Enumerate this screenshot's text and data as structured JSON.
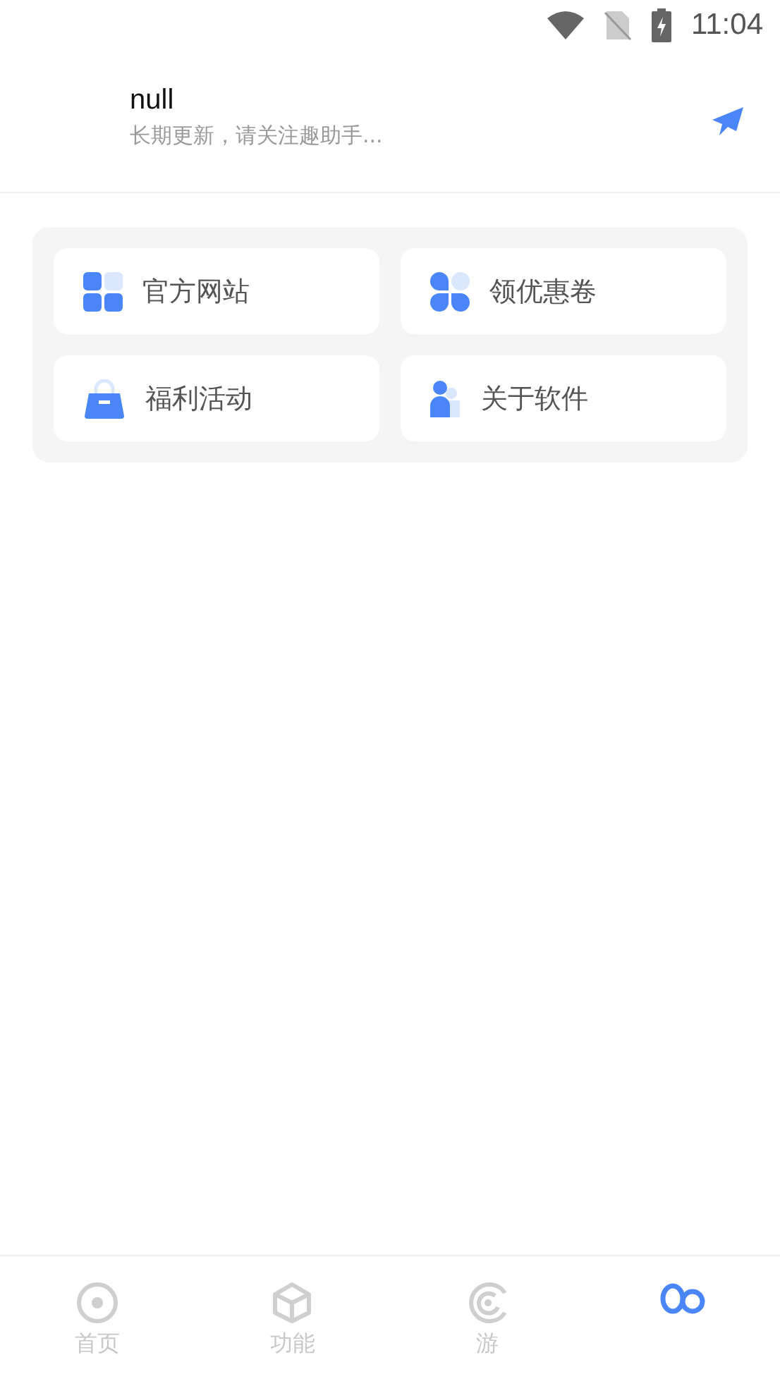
{
  "status_bar": {
    "time": "11:04"
  },
  "header": {
    "title": "null",
    "subtitle": "长期更新，请关注趣助手..."
  },
  "menu": [
    {
      "label": "官方网站",
      "kind": "grid"
    },
    {
      "label": "领优惠卷",
      "kind": "clover"
    },
    {
      "label": "福利活动",
      "kind": "bag"
    },
    {
      "label": "关于软件",
      "kind": "people"
    }
  ],
  "tabs": [
    {
      "label": "首页",
      "kind": "home",
      "selected": false
    },
    {
      "label": "功能",
      "kind": "cube",
      "selected": false
    },
    {
      "label": "游",
      "kind": "disc",
      "selected": false
    },
    {
      "kind": "loop",
      "selected": true
    }
  ]
}
